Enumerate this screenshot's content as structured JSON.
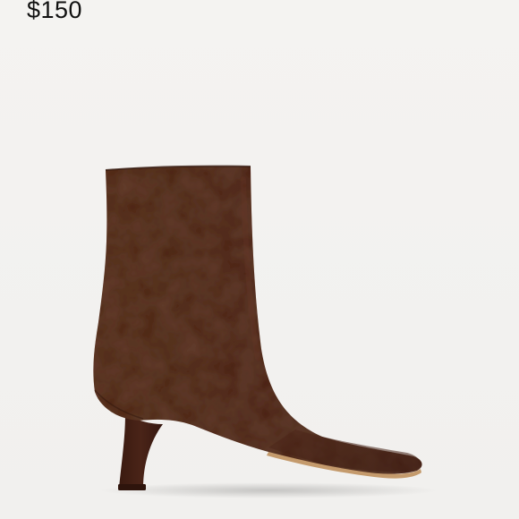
{
  "product": {
    "price": "$150"
  },
  "image": {
    "subject": "boot-photo",
    "colors": {
      "background": "#f2f1ef",
      "suede_main": "#4a2418",
      "suede_dark": "#3a1a10",
      "suede_light": "#5e3222",
      "sole": "#c49a6c"
    }
  }
}
